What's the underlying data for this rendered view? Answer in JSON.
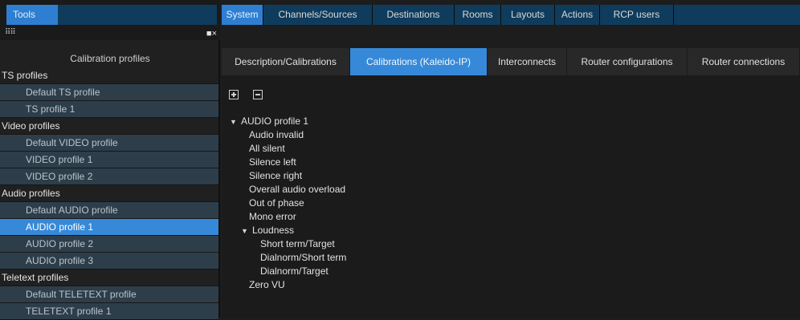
{
  "tools_tab": "Tools",
  "panel": {
    "grip_icon": "drag-grip-icon",
    "dock_icon": "■",
    "close_icon": "×",
    "header": "Calibration profiles"
  },
  "profiles": [
    {
      "type": "group",
      "label": "TS profiles"
    },
    {
      "type": "item",
      "label": "Default TS profile"
    },
    {
      "type": "item",
      "label": "TS profile 1"
    },
    {
      "type": "group",
      "label": "Video profiles"
    },
    {
      "type": "item",
      "label": "Default VIDEO profile"
    },
    {
      "type": "item",
      "label": "VIDEO profile 1"
    },
    {
      "type": "item",
      "label": "VIDEO profile 2"
    },
    {
      "type": "group",
      "label": "Audio profiles"
    },
    {
      "type": "item",
      "label": "Default AUDIO profile"
    },
    {
      "type": "item",
      "label": "AUDIO profile 1",
      "selected": true
    },
    {
      "type": "item",
      "label": "AUDIO profile 2"
    },
    {
      "type": "item",
      "label": "AUDIO profile 3"
    },
    {
      "type": "group",
      "label": "Teletext profiles"
    },
    {
      "type": "item",
      "label": "Default TELETEXT profile"
    },
    {
      "type": "item",
      "label": "TELETEXT profile 1"
    }
  ],
  "nav_tabs": [
    "System",
    "Channels/Sources",
    "Destinations",
    "Rooms",
    "Layouts",
    "Actions",
    "RCP users"
  ],
  "nav_active": "System",
  "sub_tabs": [
    "Description/Calibrations",
    "Calibrations (Kaleido-IP)",
    "Interconnects",
    "Router configurations",
    "Router connections"
  ],
  "sub_active": "Calibrations (Kaleido-IP)",
  "tree": [
    {
      "level": 0,
      "label": "AUDIO profile 1",
      "expanded": true
    },
    {
      "level": 1,
      "label": "Audio invalid"
    },
    {
      "level": 1,
      "label": "All silent"
    },
    {
      "level": 1,
      "label": "Silence left"
    },
    {
      "level": 1,
      "label": "Silence right"
    },
    {
      "level": 1,
      "label": "Overall audio overload"
    },
    {
      "level": 1,
      "label": "Out of phase"
    },
    {
      "level": 1,
      "label": "Mono error"
    },
    {
      "level": 1,
      "label": "Loudness",
      "expanded": true
    },
    {
      "level": 2,
      "label": "Short term/Target"
    },
    {
      "level": 2,
      "label": "Dialnorm/Short term"
    },
    {
      "level": 2,
      "label": "Dialnorm/Target"
    },
    {
      "level": 1,
      "label": "Zero VU"
    }
  ],
  "colors": {
    "accent": "#2e7fd1",
    "nav_bg": "#0f3c5c",
    "list_item_bg": "#2d3e4a",
    "selected": "#3689d8"
  }
}
